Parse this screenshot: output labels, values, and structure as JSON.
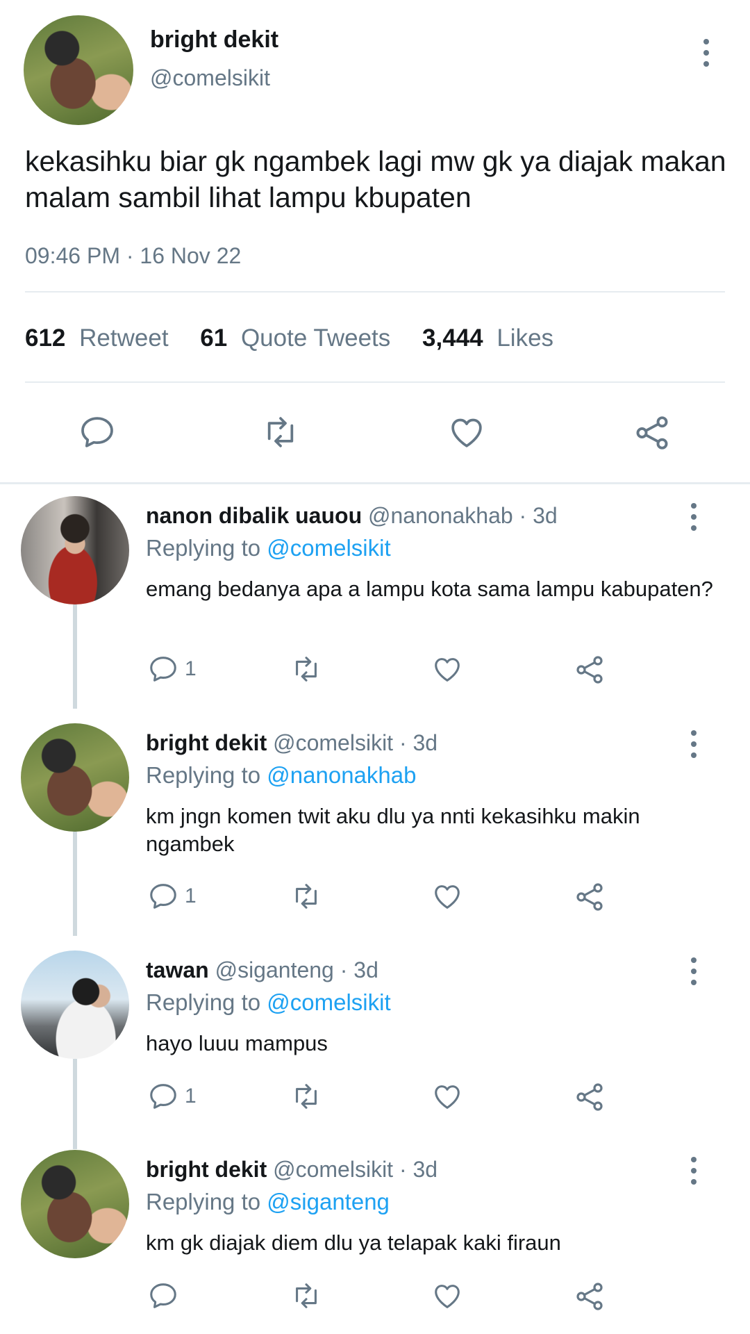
{
  "tweet": {
    "author_name": "bright dekit",
    "handle": "@comelsikit",
    "text": "kekasihku biar gk ngambek lagi mw gk ya diajak makan malam sambil lihat lampu kbupaten",
    "timestamp": "09:46 PM · 16 Nov 22",
    "stats": {
      "retweets_count": "612",
      "retweets_label": "Retweet",
      "quotes_count": "61",
      "quotes_label": "Quote Tweets",
      "likes_count": "3,444",
      "likes_label": "Likes"
    }
  },
  "replies": [
    {
      "name": "nanon dibalik uauou",
      "meta": "@nanonakhab · 3d",
      "replying_prefix": "Replying to",
      "replying_to": "@comelsikit",
      "text": "emang bedanya apa a lampu kota sama lampu kabupaten?",
      "reply_count": "1"
    },
    {
      "name": "bright dekit",
      "meta": "@comelsikit · 3d",
      "replying_prefix": "Replying to",
      "replying_to": "@nanonakhab",
      "text": "km jngn komen twit aku dlu ya nnti kekasihku makin ngambek",
      "reply_count": "1"
    },
    {
      "name": "tawan",
      "meta": "@siganteng · 3d",
      "replying_prefix": "Replying to",
      "replying_to": "@comelsikit",
      "text": "hayo luuu mampus",
      "reply_count": "1"
    },
    {
      "name": "bright dekit",
      "meta": "@comelsikit · 3d",
      "replying_prefix": "Replying to",
      "replying_to": "@siganteng",
      "text": "km gk diajak diem dlu ya telapak kaki firaun",
      "reply_count": ""
    }
  ],
  "colors": {
    "text": "#14171a",
    "muted": "#657786",
    "link": "#1da1f2",
    "divider": "#e6ecf0"
  },
  "icons": [
    "reply-icon",
    "retweet-icon",
    "like-icon",
    "share-icon",
    "more-icon"
  ]
}
